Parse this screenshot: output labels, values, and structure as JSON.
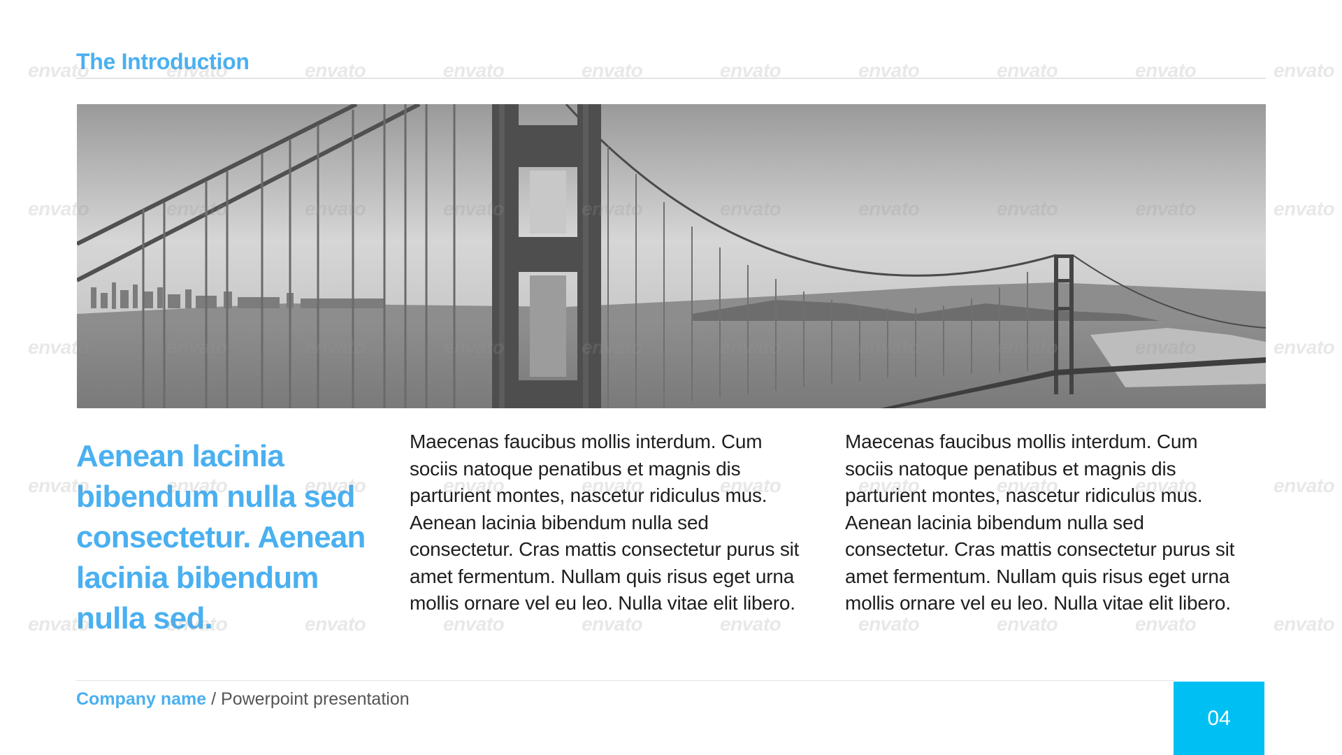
{
  "slide": {
    "title": "The Introduction",
    "lead_text": "Aenean lacinia bibendum nulla sed consectetur. Aenean lacinia bibendum nulla sed.",
    "column_1": "Maecenas faucibus mollis interdum. Cum sociis natoque penatibus et magnis dis parturient montes, nascetur ridiculus mus. Aenean lacinia bibendum nulla sed consectetur. Cras mattis consectetur purus sit amet fermentum. Nullam quis risus eget urna mollis ornare vel eu leo. Nulla vitae elit libero.",
    "column_2": "Maecenas faucibus mollis interdum. Cum sociis natoque penatibus et magnis dis parturient montes, nascetur ridiculus mus. Aenean lacinia bibendum nulla sed consectetur. Cras mattis consectetur purus sit amet fermentum. Nullam quis risus eget urna mollis ornare vel eu leo. Nulla vitae elit libero."
  },
  "footer": {
    "company": "Company name",
    "separator": " / ",
    "subtitle": "Powerpoint presentation",
    "page_number": "04"
  },
  "watermark": {
    "text": "envato"
  },
  "colors": {
    "accent": "#4ab0f0",
    "page_box": "#00bff3",
    "body_text": "#1e1e1e"
  }
}
